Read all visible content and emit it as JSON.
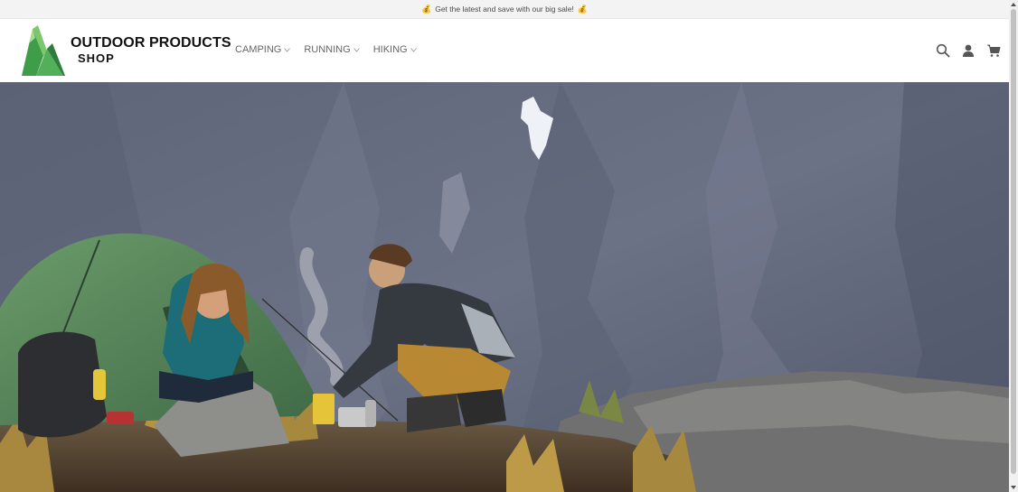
{
  "announcement": {
    "text": "Get the latest and save with our big sale!",
    "icon": "money-bag-icon"
  },
  "brand": {
    "line1": "OUTDOOR PRODUCTS",
    "line2": "SHOP",
    "logo_color": "#4caf50"
  },
  "nav": {
    "items": [
      {
        "label": "CAMPING"
      },
      {
        "label": "RUNNING"
      },
      {
        "label": "HIKING"
      }
    ]
  },
  "header_icons": [
    "search-icon",
    "account-icon",
    "cart-icon"
  ],
  "hero": {
    "subject": "campers with tent on rocky mountain ridge"
  }
}
